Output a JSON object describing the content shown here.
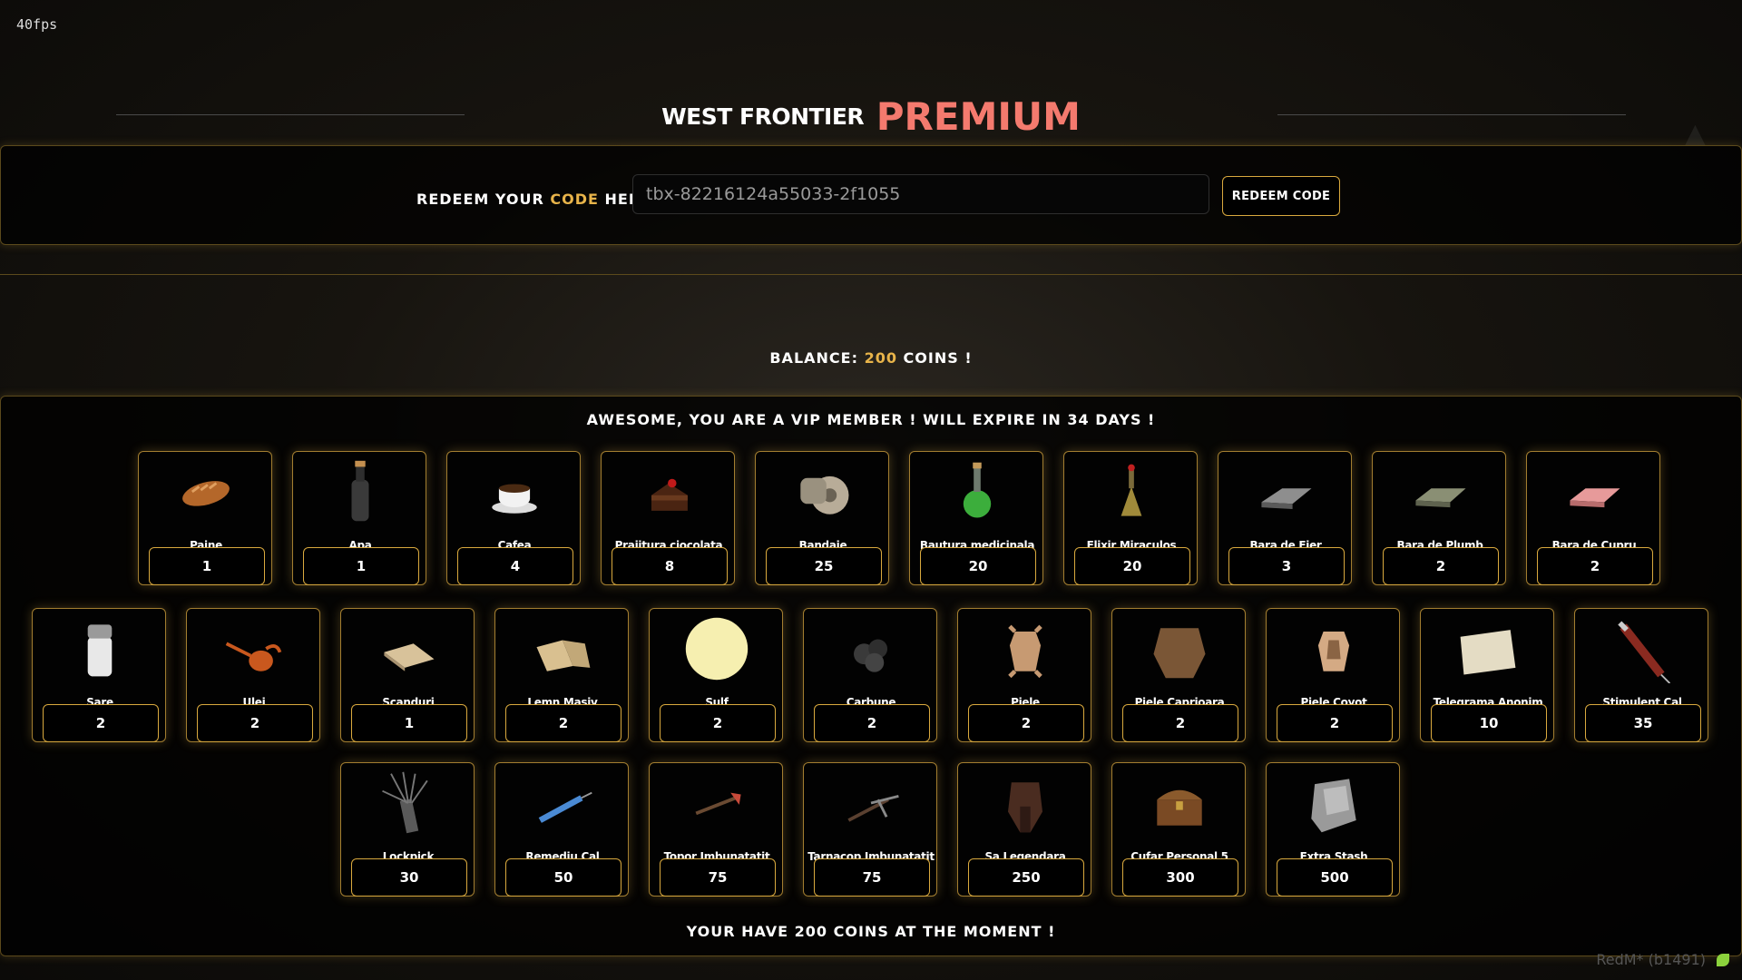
{
  "overlay": {
    "fps": "40fps",
    "client_version": "RedM* (b1491)"
  },
  "header": {
    "brand": "WEST FRONTIER",
    "premium": "PREMIUM"
  },
  "redeem": {
    "label_prefix": "REDEEM YOUR",
    "label_code": "CODE",
    "label_suffix": "HERE :",
    "input_value": "tbx-82216124a55033-2f1055",
    "button_label": "REDEEM CODE"
  },
  "balance": {
    "prefix": "BALANCE:",
    "amount": "200",
    "suffix": "COINS !"
  },
  "vip_message": "AWESOME, YOU ARE A VIP MEMBER ! WILL EXPIRE IN 34 DAYS !",
  "footer_message": "YOUR HAVE 200 COINS AT THE MOMENT !",
  "colors": {
    "accent_gold": "#e8b44a",
    "premium_red": "#f47a6e",
    "panel_border": "#a37e30"
  },
  "items": [
    {
      "name": "Paine",
      "price": "1",
      "icon": "bread-icon"
    },
    {
      "name": "Apa",
      "price": "1",
      "icon": "water-bottle-icon"
    },
    {
      "name": "Cafea",
      "price": "4",
      "icon": "coffee-cup-icon"
    },
    {
      "name": "Prajitura ciocolata",
      "price": "8",
      "icon": "chocolate-cake-icon"
    },
    {
      "name": "Bandaje",
      "price": "25",
      "icon": "bandage-icon"
    },
    {
      "name": "Bautura medicinala",
      "price": "20",
      "icon": "medicine-bottle-icon"
    },
    {
      "name": "Elixir Miraculos",
      "price": "20",
      "icon": "elixir-bottle-icon"
    },
    {
      "name": "Bara de Fier",
      "price": "3",
      "icon": "iron-bar-icon"
    },
    {
      "name": "Bara de Plumb",
      "price": "2",
      "icon": "lead-bar-icon"
    },
    {
      "name": "Bara de Cupru",
      "price": "2",
      "icon": "copper-bar-icon"
    },
    {
      "name": "Sare",
      "price": "2",
      "icon": "salt-shaker-icon"
    },
    {
      "name": "Ulei",
      "price": "2",
      "icon": "oil-can-icon"
    },
    {
      "name": "Scanduri",
      "price": "1",
      "icon": "planks-icon"
    },
    {
      "name": "Lemn Masiv",
      "price": "2",
      "icon": "solid-wood-icon"
    },
    {
      "name": "Sulf",
      "price": "2",
      "icon": "sulfur-icon"
    },
    {
      "name": "Carbune",
      "price": "2",
      "icon": "coal-icon"
    },
    {
      "name": "Piele",
      "price": "2",
      "icon": "hide-icon"
    },
    {
      "name": "Piele Caprioara",
      "price": "2",
      "icon": "deer-hide-icon"
    },
    {
      "name": "Piele Coyot",
      "price": "2",
      "icon": "coyote-hide-icon"
    },
    {
      "name": "Telegrama Anonim",
      "price": "10",
      "icon": "telegram-paper-icon"
    },
    {
      "name": "Stimulent Cal",
      "price": "35",
      "icon": "syringe-icon"
    },
    {
      "name": "Lockpick",
      "price": "30",
      "icon": "lockpick-icon"
    },
    {
      "name": "Remediu Cal",
      "price": "50",
      "icon": "horse-remedy-icon"
    },
    {
      "name": "Topor Imbunatatit",
      "price": "75",
      "icon": "axe-icon"
    },
    {
      "name": "Tarnacop Imbunatatit",
      "price": "75",
      "icon": "pickaxe-icon"
    },
    {
      "name": "Sa Legendara",
      "price": "250",
      "icon": "saddle-icon"
    },
    {
      "name": "Cufar Personal 5",
      "price": "300",
      "icon": "chest-icon"
    },
    {
      "name": "Extra Stash",
      "price": "500",
      "icon": "backpack-icon"
    }
  ]
}
